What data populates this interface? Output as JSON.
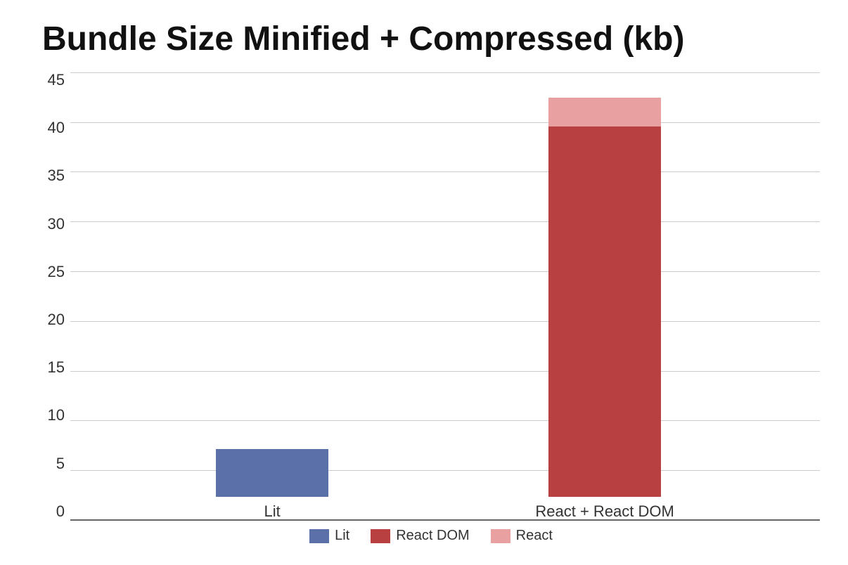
{
  "chart": {
    "title": "Bundle Size Minified + Compressed (kb)",
    "y_axis": {
      "max": 45,
      "ticks": [
        0,
        5,
        10,
        15,
        20,
        25,
        30,
        35,
        40,
        45
      ]
    },
    "bars": [
      {
        "group_label": "Lit",
        "segments": [
          {
            "name": "Lit",
            "value": 5,
            "color": "#5b6fa8"
          }
        ]
      },
      {
        "group_label": "React + React DOM",
        "segments": [
          {
            "name": "React DOM",
            "value": 39,
            "color": "#b84040"
          },
          {
            "name": "React",
            "value": 3,
            "color": "#e8a0a0"
          }
        ]
      }
    ],
    "legend": [
      {
        "label": "Lit",
        "color": "#5b6fa8"
      },
      {
        "label": "React DOM",
        "color": "#b84040"
      },
      {
        "label": "React",
        "color": "#e8a0a0"
      }
    ]
  }
}
